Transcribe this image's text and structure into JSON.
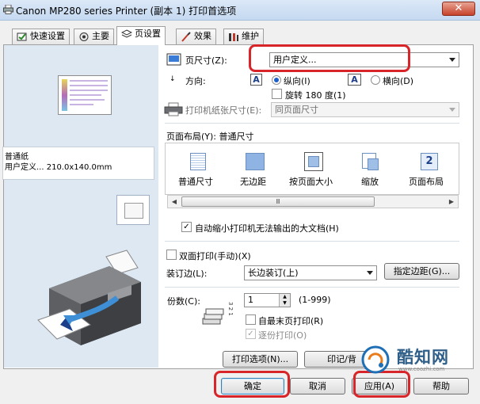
{
  "window": {
    "title": "Canon MP280 series Printer (副本 1) 打印首选项",
    "close_glyph": "✕"
  },
  "tabs": [
    {
      "label": "快速设置",
      "icon": "quick-setup-icon"
    },
    {
      "label": "主要",
      "icon": "main-icon"
    },
    {
      "label": "页设置",
      "icon": "page-setup-icon",
      "active": true
    },
    {
      "label": "效果",
      "icon": "effects-icon"
    },
    {
      "label": "维护",
      "icon": "maintenance-icon"
    }
  ],
  "preview": {
    "media_type": "普通纸",
    "media_size": "用户定义... 210.0x140.0mm"
  },
  "page_size": {
    "label": "页尺寸(Z):",
    "value": "用户定义..."
  },
  "orientation": {
    "label": "方向:",
    "portrait": "纵向(I)",
    "landscape": "横向(D)",
    "selected": "portrait",
    "rotate_label": "旋转 180 度(1)",
    "rotate_checked": false
  },
  "printer_paper_size": {
    "label": "打印机纸张尺寸(E):",
    "value": "同页面尺寸"
  },
  "page_layout": {
    "label": "页面布局(Y): 普通尺寸",
    "options": [
      "普通尺寸",
      "无边距",
      "按页面大小",
      "缩放",
      "页面布局"
    ],
    "scroll_grip": "Ⅲ",
    "scroll_left": "◀",
    "scroll_right": "▶"
  },
  "auto_reduce": {
    "label": "自动缩小打印机无法输出的大文档(H)",
    "checked": true
  },
  "duplex": {
    "label": "双面打印(手动)(X)",
    "checked": false
  },
  "stapling": {
    "label": "装订边(L):",
    "value": "长边装订(上)",
    "margin_button": "指定边距(G)..."
  },
  "copies": {
    "label": "份数(C):",
    "value": "1",
    "range": "(1-999)",
    "last_page_first": "自最末页打印(R)",
    "last_page_first_checked": false,
    "collate": "逐份打印(O)",
    "collate_checked": true,
    "stack_numbers": "3 2 1"
  },
  "buttons": {
    "print_options": "打印选项(N)...",
    "stamp": "印记/背",
    "ok": "确定",
    "cancel": "取消",
    "apply": "应用(A)",
    "help": "帮助"
  },
  "watermark": {
    "name": "酷知网",
    "url": "www.coozhi.com"
  },
  "colors": {
    "highlight": "#d8252a",
    "accent": "#1d5ec9",
    "preview_bg": "#dde8f3"
  }
}
